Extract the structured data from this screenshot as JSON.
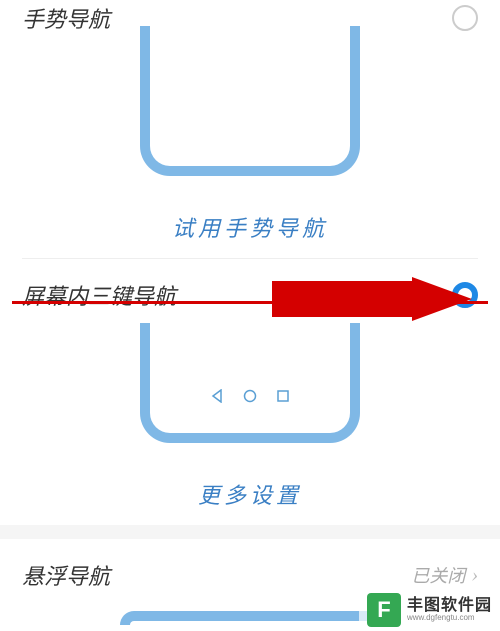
{
  "sections": {
    "gesture": {
      "title": "手势导航",
      "selected": false,
      "try_link": "试用手势导航"
    },
    "three_key": {
      "title": "屏幕内三键导航",
      "selected": true,
      "more_link": "更多设置"
    },
    "floating": {
      "title": "悬浮导航",
      "status": "已关闭"
    }
  },
  "watermark": {
    "logo_letter": "F",
    "name": "丰图软件园",
    "url": "www.dgfengtu.com"
  }
}
